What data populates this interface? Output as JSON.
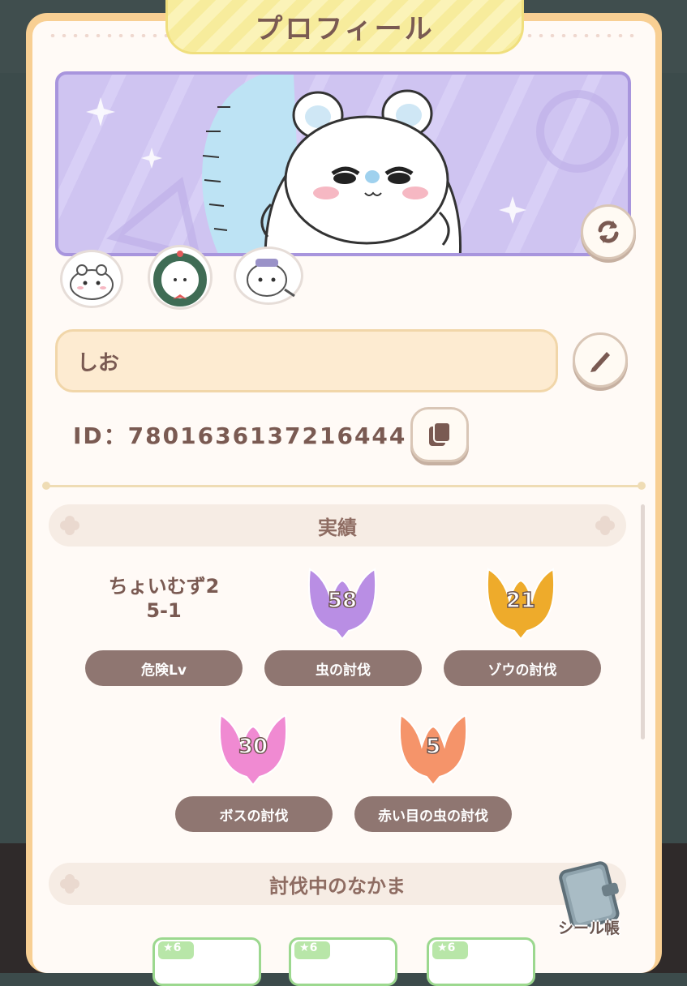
{
  "header": {
    "title": "プロフィール"
  },
  "profile": {
    "name": "しお",
    "id_label": "ID：",
    "id_value": "7801636137216444"
  },
  "achievements": {
    "heading": "実績",
    "record_line1": "ちょいむず2",
    "record_line2": "5-1",
    "items": [
      {
        "label": "危険Lv"
      },
      {
        "label": "虫の討伐",
        "count": "58",
        "color": "#b98ee4"
      },
      {
        "label": "ゾウの討伐",
        "count": "21",
        "color": "#eeab2b"
      },
      {
        "label": "ボスの討伐",
        "count": "30",
        "color": "#f08ad2"
      },
      {
        "label": "赤い目の虫の討伐",
        "count": "5",
        "color": "#f5946a"
      }
    ]
  },
  "companions": {
    "heading": "討伐中のなかま",
    "cards": [
      {
        "badge": "6"
      },
      {
        "badge": "6"
      },
      {
        "badge": "6"
      }
    ]
  },
  "sticker_book": {
    "label": "シール帳"
  },
  "icons": {
    "refresh": "refresh-icon",
    "edit": "pencil-icon",
    "copy": "copy-icon",
    "book": "sticker-book-icon"
  },
  "colors": {
    "panel_border": "#f8cf93",
    "banner_bg": "#cfc4f1",
    "text_brown": "#7a5a52",
    "pill_bg": "#8f7671"
  }
}
